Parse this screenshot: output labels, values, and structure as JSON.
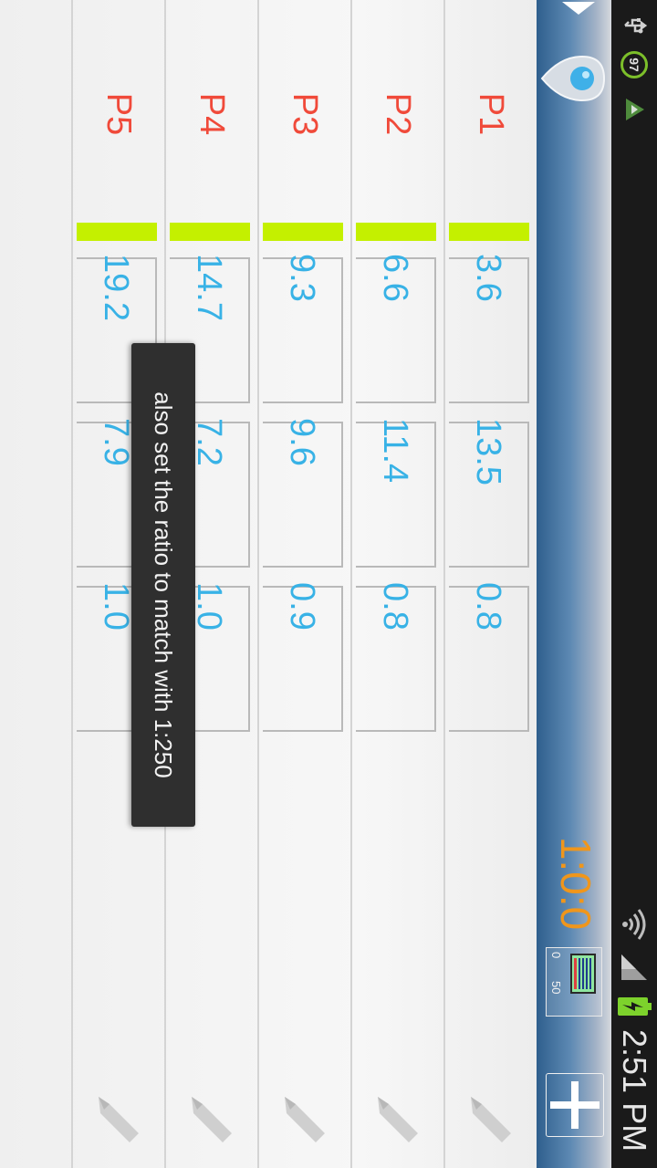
{
  "status_bar": {
    "notification_badge": "97",
    "time": "2:51 PM",
    "icons": [
      "usb-icon",
      "notification-97-icon",
      "app-notification-icon",
      "wifi-icon",
      "signal-icon",
      "battery-charging-icon"
    ]
  },
  "action_bar": {
    "timer": "1:0:0",
    "mini_chart": {
      "min_label": "0",
      "max_label": "50"
    },
    "add_icon": "plus-icon",
    "location_icon": "location-pin-icon"
  },
  "rows": [
    {
      "name": "P1",
      "values": [
        "3.6",
        "13.5",
        "0.8"
      ]
    },
    {
      "name": "P2",
      "values": [
        "6.6",
        "11.4",
        "0.8"
      ]
    },
    {
      "name": "P3",
      "values": [
        "9.3",
        "9.6",
        "0.9"
      ]
    },
    {
      "name": "P4",
      "values": [
        "14.7",
        "7.2",
        "1.0"
      ]
    },
    {
      "name": "P5",
      "values": [
        "19.2",
        "7.9",
        "1.0"
      ]
    }
  ],
  "toast": {
    "message": "also set the ratio to match with 1:250"
  },
  "colors": {
    "name_text": "#f04a3a",
    "value_text": "#38b2e6",
    "accent_bar": "#c4f000",
    "timer_text": "#f0961b"
  }
}
